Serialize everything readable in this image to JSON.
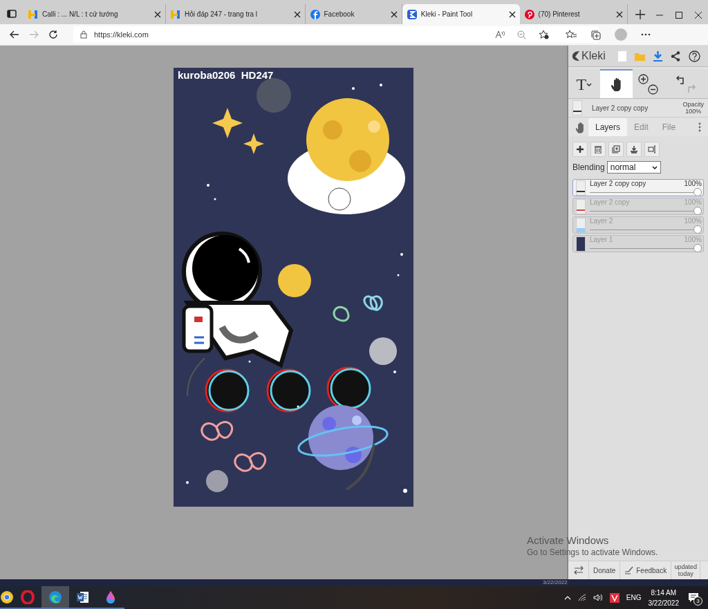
{
  "browser": {
    "tabs": [
      {
        "title": "Calli : ... N/L : t cứ tướng",
        "kind": "hoidap",
        "selected": false
      },
      {
        "title": "Hỏi đáp 247 - trang tra l",
        "kind": "hoidap",
        "selected": false
      },
      {
        "title": "Facebook",
        "kind": "facebook",
        "selected": false
      },
      {
        "title": "Kleki - Paint Tool",
        "kind": "kleki",
        "selected": true
      },
      {
        "title": "(70) Pinterest",
        "kind": "pinterest",
        "selected": false
      }
    ],
    "url": "https://kleki.com"
  },
  "canvas": {
    "caption": "kuroba0206  HD247"
  },
  "panel": {
    "logo": "Kleki",
    "tools": [
      {
        "kind": "text",
        "glyph": "T",
        "selected": false
      },
      {
        "kind": "hand",
        "selected": true
      },
      {
        "kind": "zoom",
        "selected": false
      },
      {
        "kind": "history",
        "selected": false
      }
    ],
    "current_layer": {
      "name": "Layer 2 copy copy",
      "opacity_label": "Opacity",
      "opacity": "100%"
    },
    "tabs": [
      {
        "label": "Layers",
        "selected": true
      },
      {
        "label": "Edit",
        "selected": false
      },
      {
        "label": "File",
        "selected": false
      }
    ],
    "blending": {
      "label": "Blending",
      "value": "normal"
    },
    "layers": [
      {
        "name": "Layer 2 copy copy",
        "opacity": "100%",
        "level": 1,
        "selected": true,
        "kind": "dots"
      },
      {
        "name": "Layer 2 copy",
        "opacity": "100%",
        "level": 1,
        "selected": false,
        "kind": "red"
      },
      {
        "name": "Layer 2",
        "opacity": "100%",
        "level": 1,
        "selected": false,
        "kind": "blue"
      },
      {
        "name": "Layer 1",
        "opacity": "100%",
        "level": 1,
        "selected": false,
        "kind": "art"
      }
    ],
    "footer": {
      "donate": "Donate",
      "feedback": "Feedback",
      "updated": "updated today"
    }
  },
  "windows_notice": {
    "title": "Activate Windows",
    "text": "Go to Settings to activate Windows."
  },
  "strip": {
    "date": "3/22/2022"
  },
  "taskbar": {
    "apps": [
      {
        "kind": "chrome",
        "selected": false
      },
      {
        "kind": "opera",
        "selected": false
      },
      {
        "kind": "edge",
        "selected": true
      },
      {
        "kind": "word",
        "selected": false
      },
      {
        "kind": "paint",
        "selected": false
      }
    ],
    "language": "ENG",
    "time": "8:14 AM",
    "date": "3/22/2022",
    "notifications": "3"
  }
}
